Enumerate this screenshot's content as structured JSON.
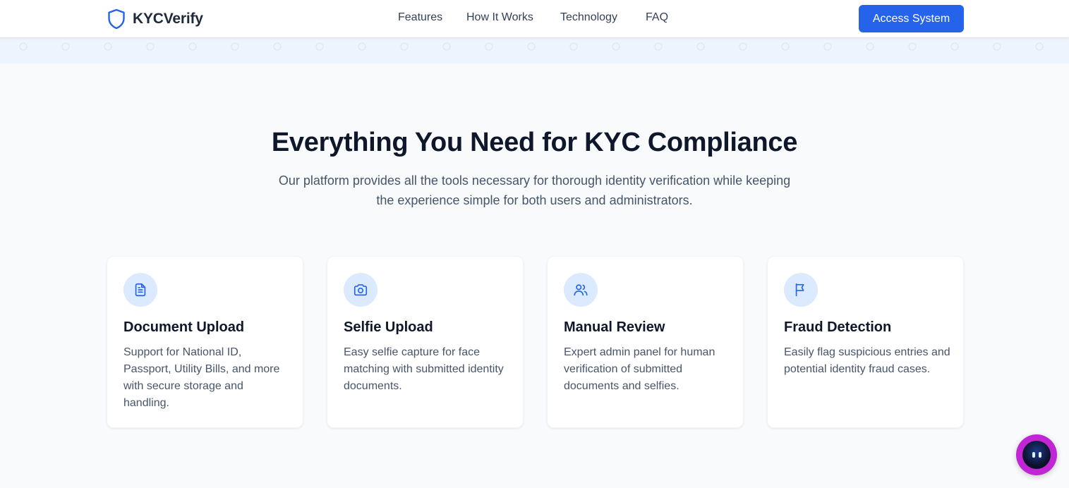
{
  "brand": {
    "name": "KYCVerify",
    "icon": "shield-icon"
  },
  "nav": {
    "links": [
      "Features",
      "How It Works",
      "Technology",
      "FAQ"
    ],
    "cta": "Access System"
  },
  "hero": {
    "title": "Everything You Need for KYC Compliance",
    "subtitle": "Our platform provides all the tools necessary for thorough identity verification while keeping the experience simple for both users and administrators."
  },
  "features": [
    {
      "icon": "document-icon",
      "title": "Document Upload",
      "description": "Support for National ID, Passport, Utility Bills, and more with secure storage and handling."
    },
    {
      "icon": "camera-icon",
      "title": "Selfie Upload",
      "description": "Easy selfie capture for face matching with submitted identity documents."
    },
    {
      "icon": "users-icon",
      "title": "Manual Review",
      "description": "Expert admin panel for human verification of submitted documents and selfies."
    },
    {
      "icon": "flag-icon",
      "title": "Fraud Detection",
      "description": "Easily flag suspicious entries and potential identity fraud cases."
    }
  ],
  "chat": {
    "icon": "chat-bot-icon"
  },
  "colors": {
    "accent": "#2563eb",
    "icon_bg": "#dbeafe",
    "page_bg": "#f8fafc",
    "chat_bg": "#c026d3"
  }
}
